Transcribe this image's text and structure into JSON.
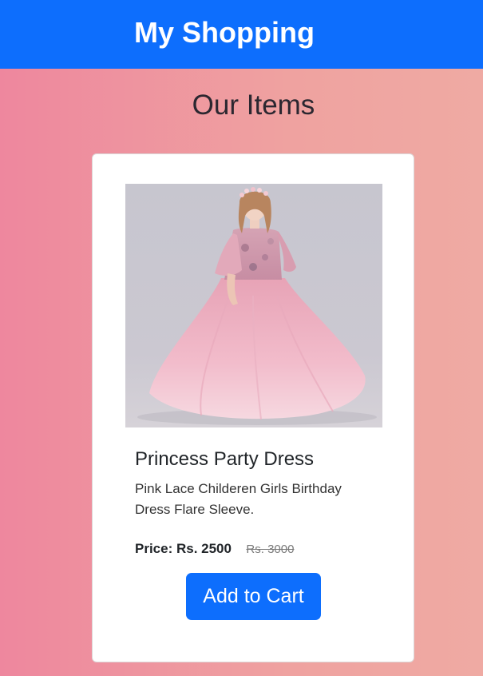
{
  "navbar": {
    "brand": "My Shopping"
  },
  "main": {
    "section_title": "Our Items"
  },
  "product": {
    "image_alt": "Princess Party Dress",
    "title": "Princess Party Dress",
    "description": "Pink Lace Childeren Girls Birthday Dress Flare Sleeve.",
    "price_label": "Price: Rs. 2500",
    "old_price": "Rs. 3000",
    "add_to_cart_label": "Add to Cart"
  },
  "colors": {
    "navbar": "#0d6efd",
    "button": "#0d6efd",
    "background_left": "#ee879e",
    "background_right": "#efaaa3"
  }
}
